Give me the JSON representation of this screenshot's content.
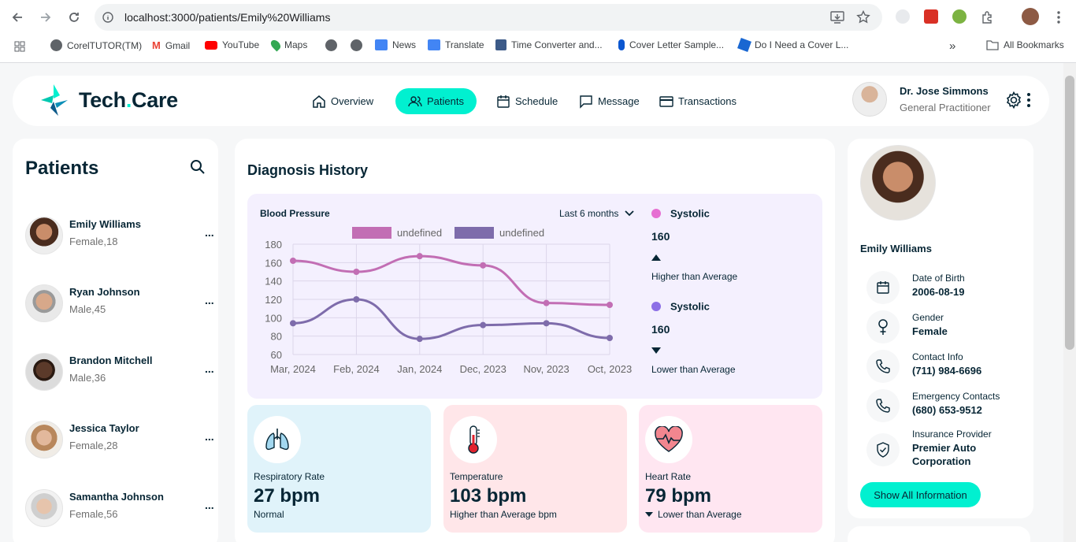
{
  "browser": {
    "url": "localhost:3000/patients/Emily%20Williams",
    "bookmarks": [
      {
        "label": "CorelTUTOR(TM)",
        "color": "#5f6368"
      },
      {
        "label": "Gmail",
        "color": "#ea4335"
      },
      {
        "label": "YouTube",
        "color": "#ff0000"
      },
      {
        "label": "Maps",
        "color": "#34a853"
      },
      {
        "label": "",
        "color": "#5f6368"
      },
      {
        "label": "",
        "color": "#5f6368"
      },
      {
        "label": "News",
        "color": "#4285f4"
      },
      {
        "label": "Translate",
        "color": "#4285f4"
      },
      {
        "label": "Time Converter and...",
        "color": "#1a73e8"
      },
      {
        "label": "Cover Letter Sample...",
        "color": "#0b57d0"
      },
      {
        "label": "Do I Need a Cover L...",
        "color": "#1967d2"
      }
    ],
    "all_bookmarks": "All Bookmarks",
    "more_glyph": "»"
  },
  "app": {
    "logo_main": "Tech",
    "logo_dot": ".",
    "logo_end": "Care",
    "menu": [
      {
        "label": "Overview",
        "icon": "home-icon"
      },
      {
        "label": "Patients",
        "icon": "users-icon"
      },
      {
        "label": "Schedule",
        "icon": "calendar-icon"
      },
      {
        "label": "Message",
        "icon": "message-icon"
      },
      {
        "label": "Transactions",
        "icon": "card-icon"
      }
    ],
    "doctor": {
      "name": "Dr. Jose Simmons",
      "role": "General Practitioner"
    }
  },
  "patients": {
    "title": "Patients",
    "list": [
      {
        "name": "Emily Williams",
        "meta": "Female,18"
      },
      {
        "name": "Ryan Johnson",
        "meta": "Male,45"
      },
      {
        "name": "Brandon Mitchell",
        "meta": "Male,36"
      },
      {
        "name": "Jessica Taylor",
        "meta": "Female,28"
      },
      {
        "name": "Samantha Johnson",
        "meta": "Female,56"
      }
    ],
    "more": "..."
  },
  "diagnosis": {
    "title": "Diagnosis History",
    "bp_title": "Blood Pressure",
    "range": "Last 6 months",
    "systolic": {
      "label": "Systolic",
      "value": "160",
      "note": "Higher than Average",
      "color": "#e66fd2"
    },
    "diastolic": {
      "label": "Systolic",
      "value": "160",
      "note": "Lower than Average",
      "color": "#8c6fe6"
    },
    "stats": [
      {
        "label": "Respiratory Rate",
        "value": "27 bpm",
        "note": "Normal",
        "bg": "#e0f3fa"
      },
      {
        "label": "Temperature",
        "value": "103 bpm",
        "note": "Higher than Average bpm",
        "bg": "#ffe6e9"
      },
      {
        "label": "Heart Rate",
        "value": "79 bpm",
        "note": "Lower than Average",
        "bg": "#ffe6f1"
      }
    ]
  },
  "chart_data": {
    "type": "line",
    "categories": [
      "Mar, 2024",
      "Feb, 2024",
      "Jan, 2024",
      "Dec, 2023",
      "Nov, 2023",
      "Oct, 2023"
    ],
    "series": [
      {
        "name": "undefined",
        "color": "#c26eb4",
        "values": [
          162,
          150,
          167,
          157,
          116,
          114
        ]
      },
      {
        "name": "undefined",
        "color": "#7e6cab",
        "values": [
          94,
          120,
          77,
          92,
          94,
          78
        ]
      }
    ],
    "ylim": [
      60,
      180
    ],
    "yticks": [
      60,
      80,
      100,
      120,
      140,
      160,
      180
    ],
    "grid": true,
    "legend": "top"
  },
  "profile": {
    "name": "Emily Williams",
    "info": [
      {
        "label": "Date of Birth",
        "value": "2006-08-19",
        "icon": "calendar-icon"
      },
      {
        "label": "Gender",
        "value": "Female",
        "icon": "female-icon"
      },
      {
        "label": "Contact Info",
        "value": "(711) 984-6696",
        "icon": "phone-icon"
      },
      {
        "label": "Emergency Contacts",
        "value": "(680) 653-9512",
        "icon": "phone-icon"
      },
      {
        "label": "Insurance Provider",
        "value": "Premier Auto Corporation",
        "icon": "shield-icon"
      }
    ],
    "button": "Show All Information"
  }
}
